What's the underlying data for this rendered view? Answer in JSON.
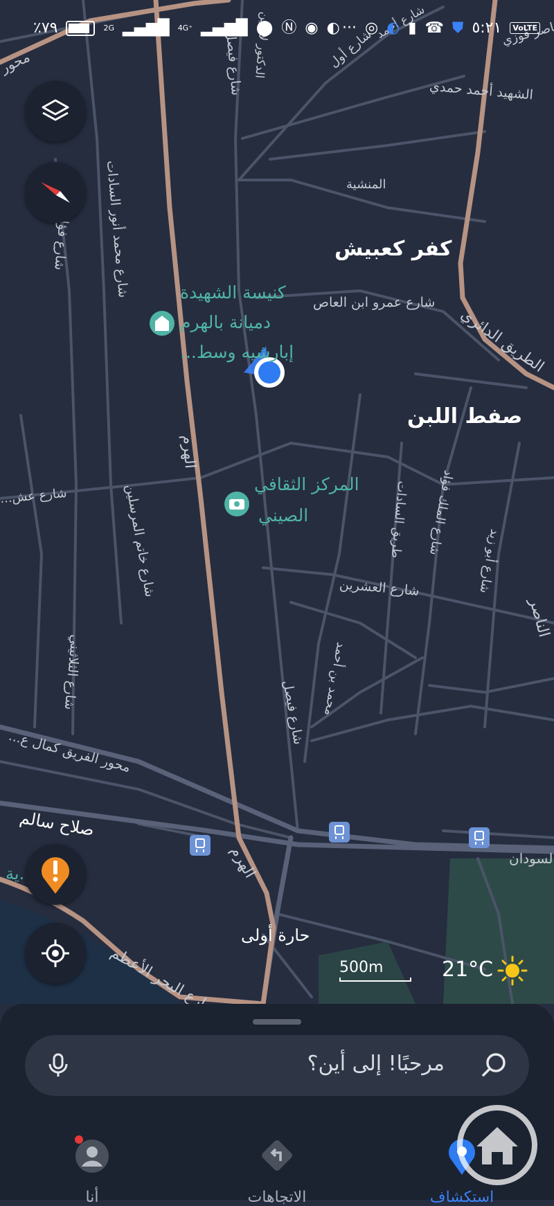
{
  "status_bar": {
    "battery_text": "٪٧٩",
    "signal_2g": "2G",
    "signal_4g": "4G⁺",
    "time": "٥:٢١",
    "volte": "VoLTE",
    "dots": "···"
  },
  "map": {
    "places": {
      "kafr_kabish": "كفر كعبيش",
      "saft_ellaban": "صفط اللبن",
      "church_line1": "كنيسة الشهيدة",
      "church_line2": "دميانة بالهرم",
      "church_line3": "إبارشيه وسط...",
      "cultural_line1": "المركز الثقافي",
      "cultural_line2": "الصيني",
      "hara_oula": "حارة أولى",
      "qariya": "القرية...ية",
      "manshia": "المنشية"
    },
    "streets": {
      "haram": "الهرم",
      "haram_2": "الهرم",
      "faisal_top": "شارع فيصل",
      "faisal_bottom": "شارع فيصل",
      "amr_ibn_alas": "شارع عمرو ابن العاص",
      "ring_road": "الطريق الدائري",
      "ahmed_hamdy": "الشهيد أحمد حمدي",
      "anwar_sadat": "شارع محمد أنور السادات",
      "fouad": "شارع فؤاد...",
      "khatem": "شارع خاتم المرسلين",
      "talateeny": "شارع الثلاثيني",
      "kamal_road": "محور الفريق كمال ع...",
      "salah_salem": "صلاح سالم",
      "bahr_aazam": "شارع البحر الأعظم",
      "ishreen": "شارع العشرين",
      "sadat_road": "طريق السادات",
      "malek_fouad": "شارع الملك فؤاد",
      "abu_zeid": "شارع أبو زيد",
      "nasser": "الناصر",
      "sudan": "السودان",
      "mohamed_ahmed": "محمد بن أحمد",
      "doctor": "الدكتور لاشين",
      "ahmed_top": "شارع أحمد",
      "street_w": "شارع عش...",
      "mehwar": "محور",
      "nasr_fawzy": "ناصر فوزي",
      "sharea_awal": "شارع أول",
      "sharea_ahmed": "شارع أحمد"
    },
    "scale_label": "500m",
    "temperature": "21°C"
  },
  "search": {
    "placeholder": "مرحبًا! إلى أين؟"
  },
  "bottom_nav": {
    "me": "أنا",
    "directions": "الاتجاهات",
    "explore": "استكشاف"
  },
  "colors": {
    "map_bg": "#262d3f",
    "road": "#4b5468",
    "main_road": "#b79383",
    "accent": "#3b82f6",
    "poi": "#4fb4a5",
    "warning": "#f08c22"
  }
}
